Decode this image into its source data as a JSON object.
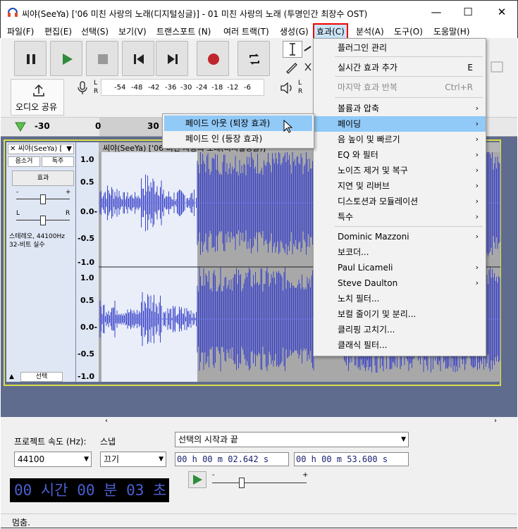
{
  "window": {
    "title": "씨야(SeeYa) ['06 미친 사랑의 노래(디지털싱글)] - 01 미친 사랑의 노래 (투명인간 최장수 OST)",
    "minimize": "—",
    "maximize": "☐",
    "close": "✕"
  },
  "menubar": [
    "파일(F)",
    "편집(E)",
    "선택(S)",
    "보기(V)",
    "트랜스포트 (N)",
    "여러 트랙(T)",
    "생성(G)",
    "효과(C)",
    "분석(A)",
    "도구(O)",
    "도움말(H)"
  ],
  "toolbar": {
    "share_label": "오디오 공유",
    "meter_ticks": [
      "-54",
      "-48",
      "-42",
      "-36",
      "-30",
      "-24",
      "-18",
      "-12",
      "-6"
    ],
    "lr": [
      "L",
      "R"
    ],
    "timeline_ticks": [
      "-30",
      "0",
      "30"
    ]
  },
  "effects_menu": {
    "items": [
      {
        "label": "플러그인 관리"
      },
      {
        "label": "실시간 효과 추가",
        "shortcut": "E"
      },
      {
        "label": "마지막 효과 반복",
        "shortcut": "Ctrl+R",
        "disabled": true
      },
      {
        "label": "볼륨과 압축",
        "submenu": true
      },
      {
        "label": "페이딩",
        "submenu": true,
        "selected": true
      },
      {
        "label": "음 높이 및 빠르기",
        "submenu": true
      },
      {
        "label": "EQ 와 필터",
        "submenu": true
      },
      {
        "label": "노이즈 제거 및 복구",
        "submenu": true
      },
      {
        "label": "지연 및 리버브",
        "submenu": true
      },
      {
        "label": "디스토션과 모듈레이션",
        "submenu": true
      },
      {
        "label": "특수",
        "submenu": true
      },
      {
        "label": "Dominic Mazzoni",
        "submenu": true
      },
      {
        "label": "보코더..."
      },
      {
        "label": "Paul Licameli",
        "submenu": true
      },
      {
        "label": "Steve Daulton",
        "submenu": true
      },
      {
        "label": "노치 필터..."
      },
      {
        "label": "보컬 줄이기 및 분리..."
      },
      {
        "label": "클리핑 고치기..."
      },
      {
        "label": "클래식 필터..."
      }
    ],
    "arrow": "›"
  },
  "fading_submenu": {
    "items": [
      {
        "label": "페이드 아웃 (퇴장 효과)",
        "selected": true
      },
      {
        "label": "페이드 인 (등장 효과)"
      }
    ]
  },
  "track": {
    "name": "씨야(SeeYa) [",
    "clip_title": "씨야(SeeYa) ['06 미친 사랑의 노래(디지털싱글)]",
    "mute": "음소거",
    "solo": "독주",
    "effects": "효과",
    "gain_minus": "-",
    "gain_plus": "+",
    "pan_l": "L",
    "pan_r": "R",
    "info_line1": "스테레오, 44100Hz",
    "info_line2": "32-비트 실수",
    "select": "선택",
    "scale": [
      "1.0",
      "0.5",
      "0.0-",
      "-0.5",
      "-1.0"
    ]
  },
  "bottom": {
    "rate_label": "프로젝트 속도 (Hz):",
    "snap_label": "스냅",
    "rate_value": "44100",
    "snap_value": "끄기",
    "sel_mode": "선택의 시작과 끝",
    "sel_start": "00 h 00 m 02.642 s",
    "sel_end": "00 h 00 m 53.600 s",
    "time_display": "00 시간 00 분 03 초",
    "play_minus": "-",
    "play_plus": "+"
  },
  "status": "멈춤."
}
